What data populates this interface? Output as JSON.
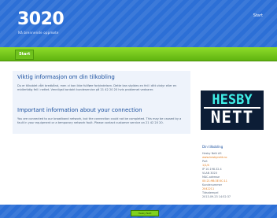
{
  "header": {
    "title": "3020",
    "subtitle": "Nå brennende oppmøte",
    "top_link": "Start"
  },
  "nav": {
    "items": [
      {
        "label": "Start"
      }
    ]
  },
  "main": {
    "heading_no": "Viktig informasjon om din tilkobling",
    "para_no": "Du er tilkoblet vårt bredbånd, men vi kan ikke fullføre forbindelsen. Dette kan skyldes en feil i ditt utstyr eller en midlertidig feil i nettet. Vennligst kontakt kundeservice på 21 42 20 20 hvis problemet vedvarer.",
    "heading_en": "Important information about your connection",
    "para_en": "You are connected to our broadband network, but the connection could not be completed. This may be caused by a fault in your equipment or a temporary network fault. Please contact customer service on 21 42 20 20."
  },
  "brand": {
    "top": "HESBY",
    "bottom": "NETT"
  },
  "sidebar": {
    "title": "Din tilkobling",
    "lines": [
      "Hesby Nett AS",
      "www.hesbynett.no",
      "Port",
      "1/1/4",
      "IP 10.198.32.4",
      "VLAN 3020",
      "MAC-adresse",
      "00:21:9B:3E:5C:11",
      "Kundenummer",
      "2042211",
      "Tidsstempel",
      "2013-09-23 14:52:37"
    ]
  },
  "footer": {
    "badge": "Hesby Nett"
  },
  "colors": {
    "header": "#2c6fd6",
    "nav": "#6fc21d",
    "brand_bg": "#0c1d36",
    "brand_accent": "#3ff0e8"
  }
}
